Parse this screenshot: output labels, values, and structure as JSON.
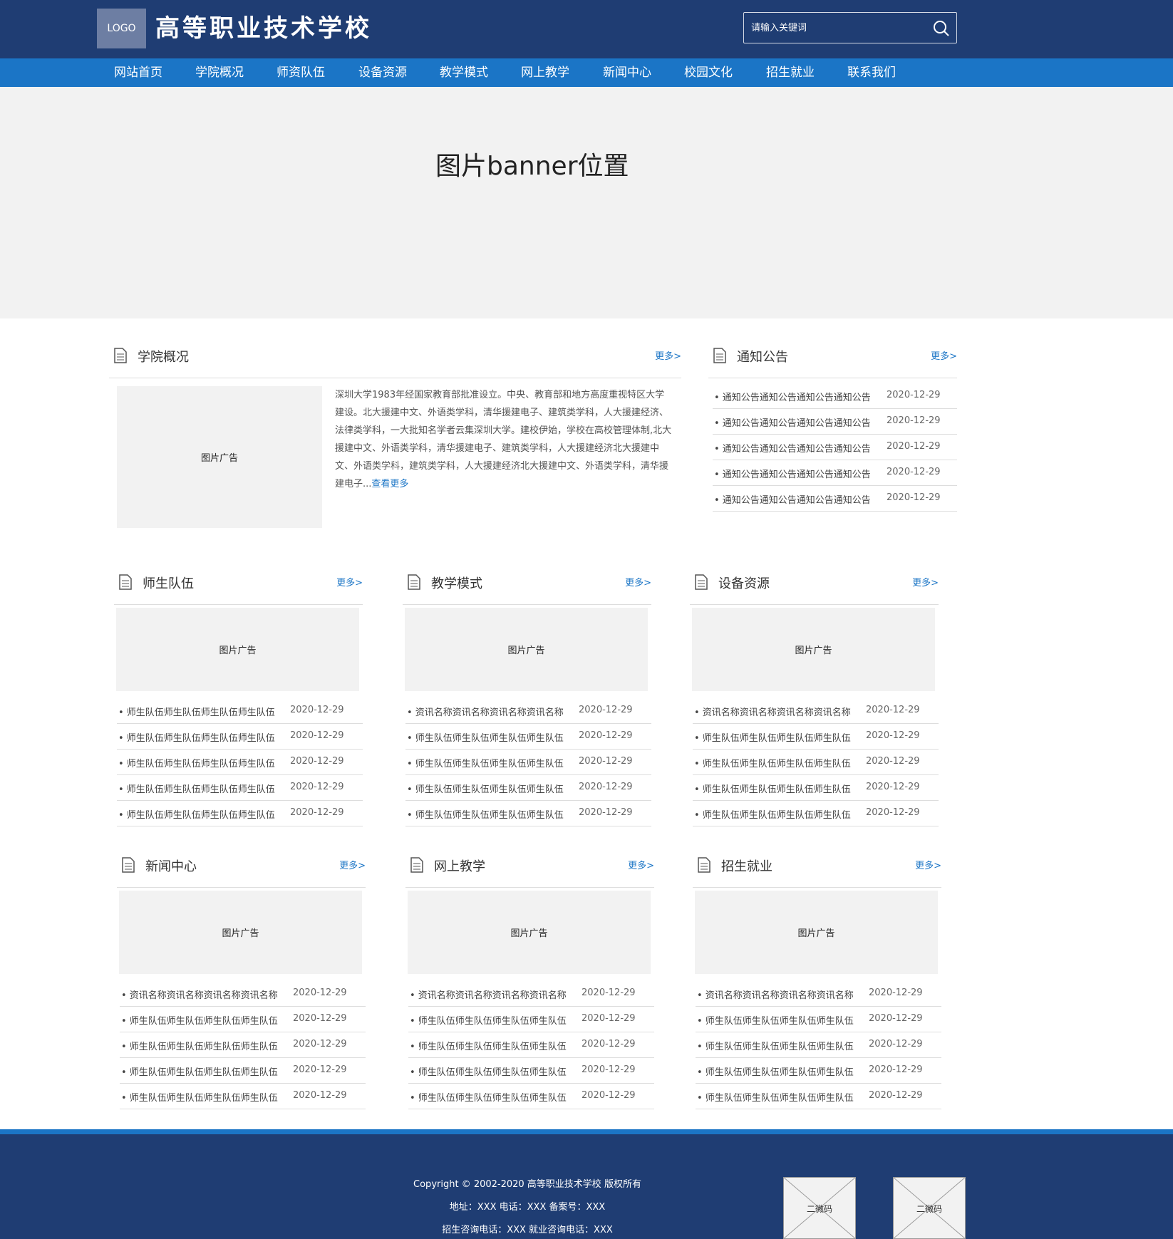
{
  "header": {
    "logo_label": "LOGO",
    "site_title": "高等职业技术学校",
    "search_placeholder": "请输入关键词"
  },
  "nav": [
    "网站首页",
    "学院概况",
    "师资队伍",
    "设备资源",
    "教学模式",
    "网上教学",
    "新闻中心",
    "校园文化",
    "招生就业",
    "联系我们"
  ],
  "banner": {
    "text": "图片banner位置"
  },
  "more_label": "更多>",
  "ad_label": "图片广告",
  "intro": {
    "title": "学院概况",
    "text": "深圳大学1983年经国家教育部批准设立。中央、教育部和地方高度重视特区大学建设。北大援建中文、外语类学科，清华援建电子、建筑类学科，人大援建经济、法律类学科，一大批知名学者云集深圳大学。建校伊始，学校在高校管理体制,北大援建中文、外语类学科，清华援建电子、建筑类学科，人大援建经济北大援建中文、外语类学科，建筑类学科，人大援建经济北大援建中文、外语类学科，清华援建电子...",
    "read_more": "查看更多"
  },
  "notice": {
    "title": "通知公告",
    "items": [
      {
        "title": "通知公告通知公告通知公告通知公告",
        "date": "2020-12-29"
      },
      {
        "title": "通知公告通知公告通知公告通知公告",
        "date": "2020-12-29"
      },
      {
        "title": "通知公告通知公告通知公告通知公告",
        "date": "2020-12-29"
      },
      {
        "title": "通知公告通知公告通知公告通知公告",
        "date": "2020-12-29"
      },
      {
        "title": "通知公告通知公告通知公告通知公告",
        "date": "2020-12-29"
      }
    ]
  },
  "sections": [
    {
      "title": "师生队伍",
      "items": [
        {
          "title": "师生队伍师生队伍师生队伍师生队伍",
          "date": "2020-12-29"
        },
        {
          "title": "师生队伍师生队伍师生队伍师生队伍",
          "date": "2020-12-29"
        },
        {
          "title": "师生队伍师生队伍师生队伍师生队伍",
          "date": "2020-12-29"
        },
        {
          "title": "师生队伍师生队伍师生队伍师生队伍",
          "date": "2020-12-29"
        },
        {
          "title": "师生队伍师生队伍师生队伍师生队伍",
          "date": "2020-12-29"
        }
      ]
    },
    {
      "title": "教学模式",
      "items": [
        {
          "title": "资讯名称资讯名称资讯名称资讯名称",
          "date": "2020-12-29"
        },
        {
          "title": "师生队伍师生队伍师生队伍师生队伍",
          "date": "2020-12-29"
        },
        {
          "title": "师生队伍师生队伍师生队伍师生队伍",
          "date": "2020-12-29"
        },
        {
          "title": "师生队伍师生队伍师生队伍师生队伍",
          "date": "2020-12-29"
        },
        {
          "title": "师生队伍师生队伍师生队伍师生队伍",
          "date": "2020-12-29"
        }
      ]
    },
    {
      "title": "设备资源",
      "items": [
        {
          "title": "资讯名称资讯名称资讯名称资讯名称",
          "date": "2020-12-29"
        },
        {
          "title": "师生队伍师生队伍师生队伍师生队伍",
          "date": "2020-12-29"
        },
        {
          "title": "师生队伍师生队伍师生队伍师生队伍",
          "date": "2020-12-29"
        },
        {
          "title": "师生队伍师生队伍师生队伍师生队伍",
          "date": "2020-12-29"
        },
        {
          "title": "师生队伍师生队伍师生队伍师生队伍",
          "date": "2020-12-29"
        }
      ]
    },
    {
      "title": "新闻中心",
      "items": [
        {
          "title": "资讯名称资讯名称资讯名称资讯名称",
          "date": "2020-12-29"
        },
        {
          "title": "师生队伍师生队伍师生队伍师生队伍",
          "date": "2020-12-29"
        },
        {
          "title": "师生队伍师生队伍师生队伍师生队伍",
          "date": "2020-12-29"
        },
        {
          "title": "师生队伍师生队伍师生队伍师生队伍",
          "date": "2020-12-29"
        },
        {
          "title": "师生队伍师生队伍师生队伍师生队伍",
          "date": "2020-12-29"
        }
      ]
    },
    {
      "title": "网上教学",
      "items": [
        {
          "title": "资讯名称资讯名称资讯名称资讯名称",
          "date": "2020-12-29"
        },
        {
          "title": "师生队伍师生队伍师生队伍师生队伍",
          "date": "2020-12-29"
        },
        {
          "title": "师生队伍师生队伍师生队伍师生队伍",
          "date": "2020-12-29"
        },
        {
          "title": "师生队伍师生队伍师生队伍师生队伍",
          "date": "2020-12-29"
        },
        {
          "title": "师生队伍师生队伍师生队伍师生队伍",
          "date": "2020-12-29"
        }
      ]
    },
    {
      "title": "招生就业",
      "items": [
        {
          "title": "资讯名称资讯名称资讯名称资讯名称",
          "date": "2020-12-29"
        },
        {
          "title": "师生队伍师生队伍师生队伍师生队伍",
          "date": "2020-12-29"
        },
        {
          "title": "师生队伍师生队伍师生队伍师生队伍",
          "date": "2020-12-29"
        },
        {
          "title": "师生队伍师生队伍师生队伍师生队伍",
          "date": "2020-12-29"
        },
        {
          "title": "师生队伍师生队伍师生队伍师生队伍",
          "date": "2020-12-29"
        }
      ]
    }
  ],
  "footer": {
    "copyright": "Copyright © 2002-2020 高等职业技术学校 版权所有",
    "address": "地址：XXX 电话：XXX 备案号：XXX",
    "hotline": "招生咨询电话：XXX 就业咨询电话：XXX",
    "qr_labels": [
      "二微码",
      "二微码"
    ]
  },
  "colors": {
    "header_bg": "#1f3d73",
    "nav_bg": "#1b75c6",
    "accent": "#1b75c6",
    "placeholder_bg": "#f2f2f2"
  },
  "icons": [
    "search-icon",
    "document-icon"
  ]
}
